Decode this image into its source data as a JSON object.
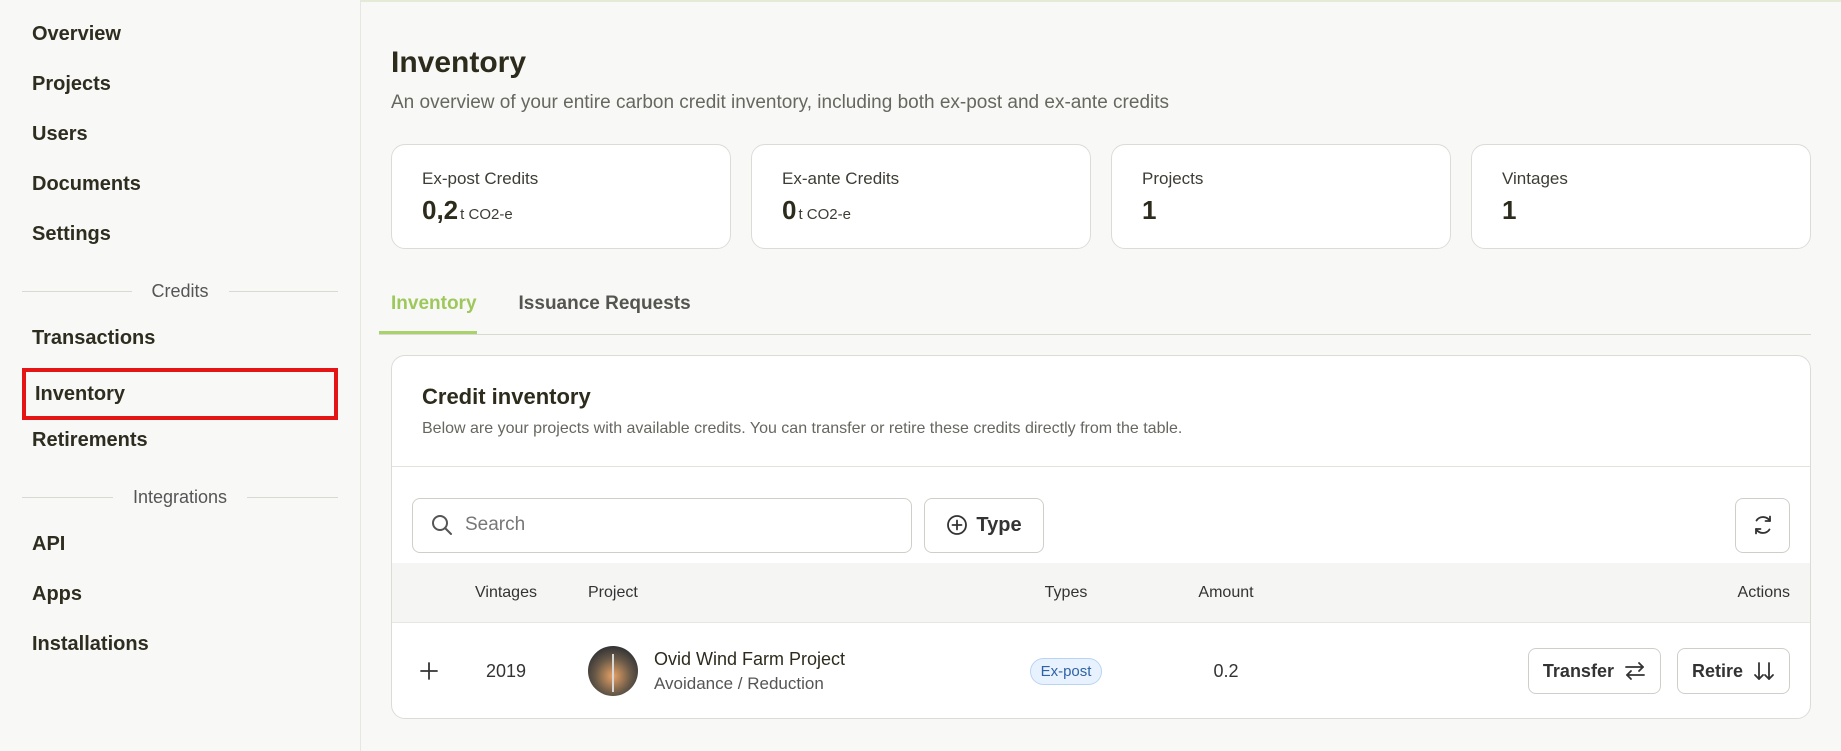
{
  "sidebar": {
    "items_top": [
      {
        "label": "Overview"
      },
      {
        "label": "Projects"
      },
      {
        "label": "Users"
      },
      {
        "label": "Documents"
      },
      {
        "label": "Settings"
      }
    ],
    "section_credits": "Credits",
    "items_credits": [
      {
        "label": "Transactions"
      },
      {
        "label": "Inventory"
      },
      {
        "label": "Retirements"
      }
    ],
    "section_integrations": "Integrations",
    "items_integrations": [
      {
        "label": "API"
      },
      {
        "label": "Apps"
      },
      {
        "label": "Installations"
      }
    ]
  },
  "page": {
    "title": "Inventory",
    "subtitle": "An overview of your entire carbon credit inventory, including both ex-post and ex-ante credits"
  },
  "stats": [
    {
      "label": "Ex-post Credits",
      "value": "0,2",
      "unit": "t CO2-e"
    },
    {
      "label": "Ex-ante Credits",
      "value": "0",
      "unit": "t CO2-e"
    },
    {
      "label": "Projects",
      "value": "1",
      "unit": ""
    },
    {
      "label": "Vintages",
      "value": "1",
      "unit": ""
    }
  ],
  "tabs": [
    {
      "label": "Inventory",
      "active": true
    },
    {
      "label": "Issuance Requests",
      "active": false
    }
  ],
  "panel": {
    "title": "Credit inventory",
    "description": "Below are your projects with available credits. You can transfer or retire these credits directly from the table.",
    "search_placeholder": "Search",
    "type_button": "Type"
  },
  "table": {
    "headers": {
      "vintages": "Vintages",
      "project": "Project",
      "types": "Types",
      "amount": "Amount",
      "actions": "Actions"
    },
    "rows": [
      {
        "vintage": "2019",
        "project_name": "Ovid Wind Farm Project",
        "project_category": "Avoidance / Reduction",
        "type": "Ex-post",
        "amount": "0.2",
        "transfer_label": "Transfer",
        "retire_label": "Retire"
      }
    ]
  },
  "colors": {
    "accent": "#a9d36a",
    "highlight_border": "#e51515",
    "badge_bg": "#e8f2ff",
    "badge_text": "#2f62a5"
  }
}
